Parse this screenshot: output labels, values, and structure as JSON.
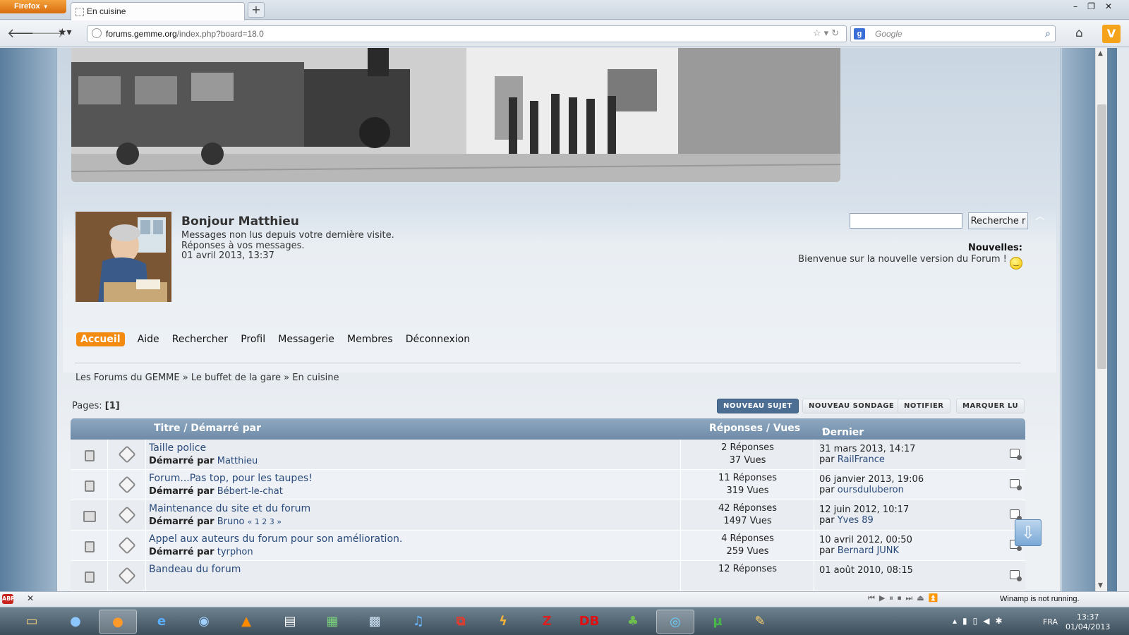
{
  "browser": {
    "app_button": "Firefox",
    "tab_title": "En cuisine",
    "url_domain": "forums.gemme.org",
    "url_prefix": "",
    "url_suffix": "/index.php?board=18.0",
    "search_placeholder": "Google"
  },
  "user": {
    "greeting": "Bonjour Matthieu",
    "unread_link": "Messages non lus depuis votre dernière visite.",
    "replies_link": "Réponses à vos messages.",
    "datetime": "01 avril 2013, 13:37"
  },
  "search": {
    "button": "Recherche r"
  },
  "news": {
    "title": "Nouvelles:",
    "text": "Bienvenue sur la nouvelle version du Forum !"
  },
  "menu": [
    "Accueil",
    "Aide",
    "Rechercher",
    "Profil",
    "Messagerie",
    "Membres",
    "Déconnexion"
  ],
  "breadcrumb": [
    "Les Forums du GEMME",
    "Le buffet de la gare",
    "En cuisine"
  ],
  "pages": {
    "label": "Pages:",
    "current": "[1]"
  },
  "actions": [
    "NOUVEAU SUJET",
    "NOUVEAU SONDAGE",
    "NOTIFIER",
    "MARQUER LU"
  ],
  "table": {
    "col_title": "Titre / Démarré par",
    "col_replies": "Réponses / Vues",
    "col_last": "Dernier message",
    "started_by": "Démarré par",
    "by": "par",
    "rows": [
      {
        "title": "Taille police",
        "author": "Matthieu",
        "replies": "2 Réponses",
        "views": "37 Vues",
        "last_date": "31 mars 2013, 14:17",
        "last_by": "RailFrance",
        "pages": ""
      },
      {
        "title": "Forum...Pas top, pour les taupes!",
        "author": "Bébert-le-chat",
        "replies": "11 Réponses",
        "views": "319 Vues",
        "last_date": "06 janvier 2013, 19:06",
        "last_by": "oursduluberon",
        "pages": ""
      },
      {
        "title": "Maintenance du site et du forum",
        "author": "Bruno",
        "replies": "42 Réponses",
        "views": "1497 Vues",
        "last_date": "12 juin 2012, 10:17",
        "last_by": "Yves 89",
        "pages": "« 1 2 3 »"
      },
      {
        "title": "Appel aux auteurs du forum pour son amélioration.",
        "author": "tyrphon",
        "replies": "4 Réponses",
        "views": "259 Vues",
        "last_date": "10 avril 2012, 00:50",
        "last_by": "Bernard JUNK",
        "pages": ""
      },
      {
        "title": "Bandeau du forum",
        "author": "",
        "replies": "12 Réponses",
        "views": "",
        "last_date": "01 août 2010, 08:15",
        "last_by": "",
        "pages": ""
      }
    ]
  },
  "addon_bar": {
    "status": "Winamp is not running."
  },
  "taskbar": {
    "lang": "FRA",
    "time": "13:37",
    "date": "01/04/2013"
  }
}
